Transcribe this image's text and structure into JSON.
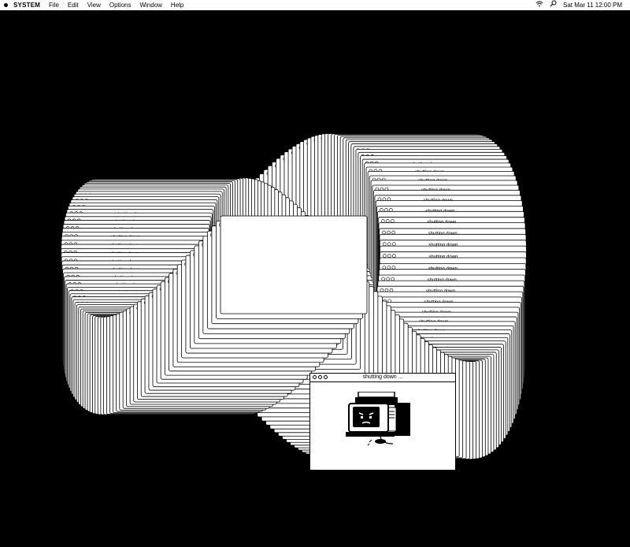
{
  "menubar": {
    "app_name": "SYSTEM",
    "menus": [
      "File",
      "Edit",
      "View",
      "Options",
      "Window",
      "Help"
    ],
    "clock": "Sat Mar 11  12:00 PM",
    "icons": [
      "apple-logo",
      "wifi-icon",
      "search-icon"
    ]
  },
  "window": {
    "title": "shutting down ...",
    "trail_label": "shutting down",
    "illustration": "retro-computer-with-sad-face"
  },
  "colors": {
    "background": "#000000",
    "foreground": "#ffffff",
    "stroke": "#000000"
  }
}
